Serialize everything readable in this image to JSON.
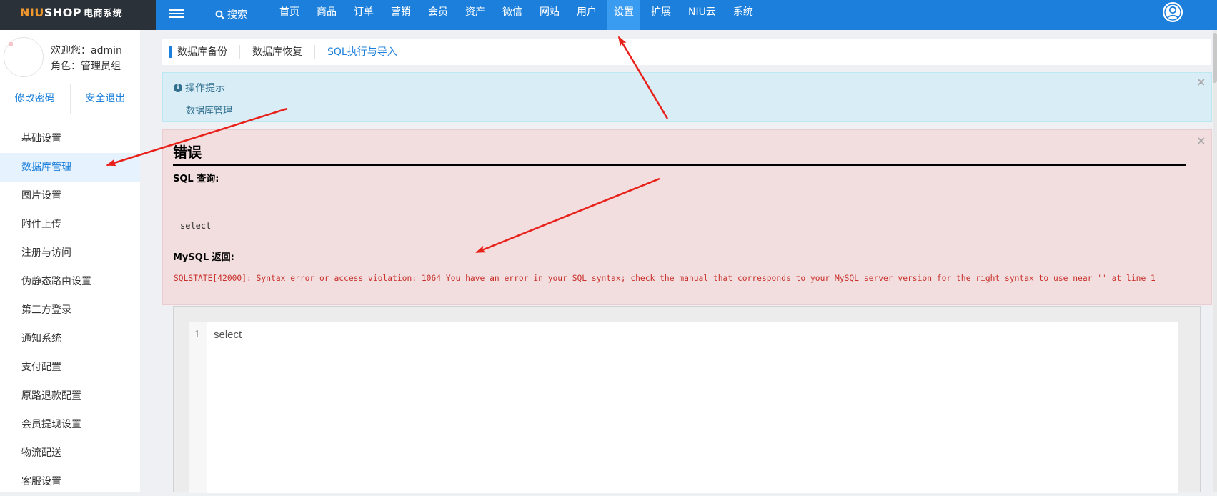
{
  "topbar": {
    "logo_niu": "NIU",
    "logo_shop": "SHOP",
    "logo_sys": "电商系统",
    "search_label": "搜索",
    "nav": [
      "首页",
      "商品",
      "订单",
      "营销",
      "会员",
      "资产",
      "微信",
      "网站",
      "用户",
      "设置",
      "扩展",
      "NIU云",
      "系统"
    ],
    "nav_active": "设置"
  },
  "sidebar": {
    "welcome": "欢迎您：admin",
    "role": "角色：管理员组",
    "change_password": "修改密码",
    "logout": "安全退出",
    "items": [
      "基础设置",
      "数据库管理",
      "图片设置",
      "附件上传",
      "注册与访问",
      "伪静态路由设置",
      "第三方登录",
      "通知系统",
      "支付配置",
      "原路退款配置",
      "会员提现设置",
      "物流配送",
      "客服设置"
    ],
    "active_item": "数据库管理"
  },
  "tabs": [
    "数据库备份",
    "数据库恢复",
    "SQL执行与导入"
  ],
  "info": {
    "title": "操作提示",
    "text": "数据库管理",
    "close": "×"
  },
  "error": {
    "title": "错误",
    "sql_label": "SQL 查询:",
    "sql_code": "select",
    "mysql_label": "MySQL 返回:",
    "mysql_message": "SQLSTATE[42000]: Syntax error or access violation: 1064 You have an error in your SQL syntax; check the manual that corresponds to your MySQL server version for the right syntax to use near '' at line 1",
    "close": "×"
  },
  "editor": {
    "line_number": "1",
    "code": "select"
  },
  "colors": {
    "primary": "#1b7fdb",
    "logo_dark": "#2b3138",
    "logo_orange": "#f0972d",
    "info_bg": "#d9edf7",
    "error_bg": "#f2dede",
    "error_text": "#c9302c",
    "annotation_arrow": "#e8201a"
  }
}
